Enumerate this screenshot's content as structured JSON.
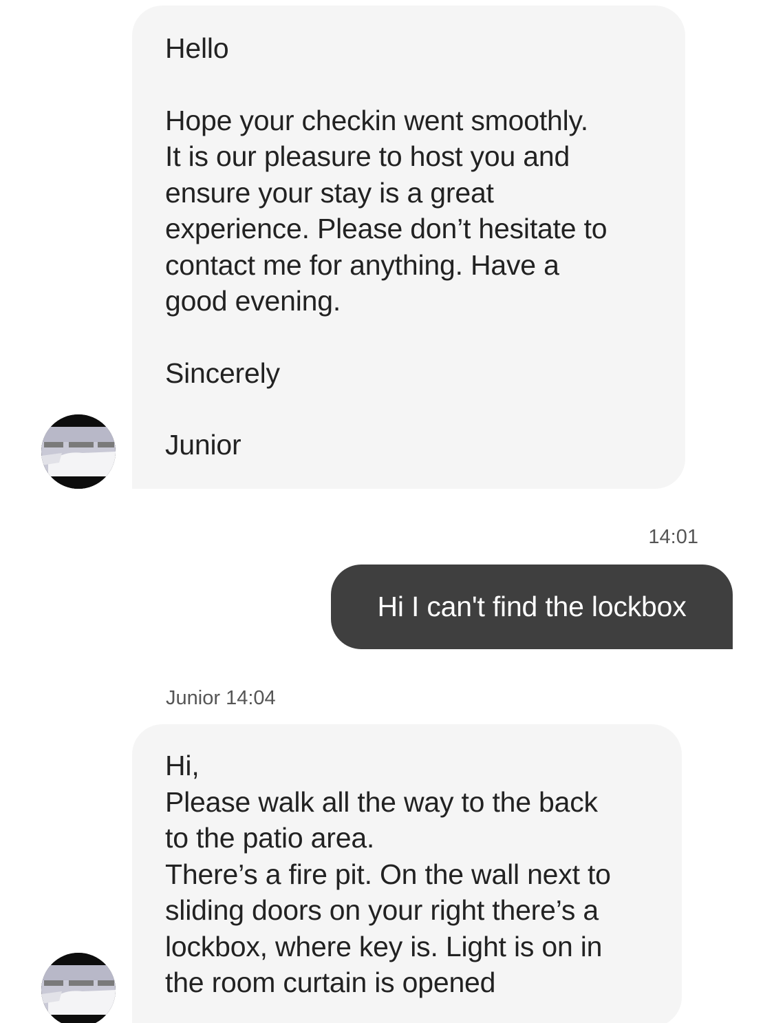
{
  "messages": {
    "first": {
      "greeting": "Hello",
      "line1": "Hope your checkin went smoothly.",
      "line2": "It is our pleasure to host you and",
      "line3": "ensure your stay is a great",
      "line4": "experience.  Please don’t hesitate to",
      "line5": "contact me for anything. Have a",
      "line6": "good evening.",
      "signoff": "Sincerely",
      "signature": "Junior"
    },
    "sent": {
      "time": "14:01",
      "text": "Hi I can't find the lockbox"
    },
    "reply": {
      "sender": "Junior",
      "time": "14:04",
      "line1": "Hi,",
      "line2": "Please  walk all the way to the back",
      "line3": "to the patio area.",
      "line4": "There’s a fire pit. On the wall next to",
      "line5": "sliding doors on your right there’s a",
      "line6": "lockbox, where key is. Light is on in",
      "line7": "the room curtain is opened"
    }
  },
  "colors": {
    "incoming_bubble": "#f5f5f5",
    "outgoing_bubble": "#3f3f3f",
    "timestamp": "#555555"
  },
  "icons": {
    "avatar": "host-avatar-bedroom-photo"
  }
}
